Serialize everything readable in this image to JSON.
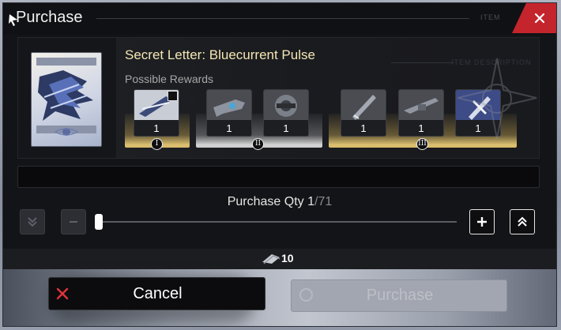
{
  "dialog": {
    "title": "Purchase",
    "title_deco": "ITEM",
    "close_icon": "close-icon"
  },
  "item": {
    "name": "Secret Letter: Bluecurrent Pulse",
    "name_deco": "ITEM DESCRIPTION",
    "rewards_label": "Possible Rewards",
    "tiers": [
      {
        "badge": "I",
        "color": "#d9bc6c"
      },
      {
        "badge": "II",
        "color": "#cfcfcf"
      },
      {
        "badge": "III",
        "color": "#d9bc6c"
      }
    ],
    "rewards": [
      {
        "qty": "1",
        "tier": "I",
        "icon": "sword-scroll-icon"
      },
      {
        "qty": "1",
        "tier": "II",
        "icon": "firearm-icon"
      },
      {
        "qty": "1",
        "tier": "II",
        "icon": "gear-cube-icon"
      },
      {
        "qty": "1",
        "tier": "III",
        "icon": "blade-icon"
      },
      {
        "qty": "1",
        "tier": "III",
        "icon": "rifle-icon"
      },
      {
        "qty": "1",
        "tier": "III",
        "icon": "cross-sword-icon"
      }
    ]
  },
  "quantity": {
    "label": "Purchase Qty",
    "current": "1",
    "separator": "/",
    "max": "71",
    "fraction": 0.0
  },
  "cost": {
    "icon": "currency-icon",
    "value": "10"
  },
  "buttons": {
    "cancel": "Cancel",
    "purchase": "Purchase"
  },
  "colors": {
    "accent_close": "#c4242c",
    "item_name": "#f4e6b4"
  }
}
